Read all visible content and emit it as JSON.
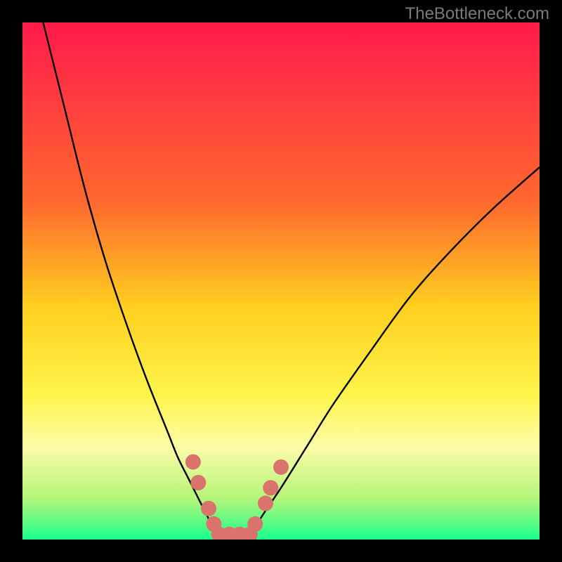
{
  "watermark": "TheBottleneck.com",
  "chart_data": {
    "type": "line",
    "title": "",
    "xlabel": "",
    "ylabel": "",
    "xlim": [
      0,
      100
    ],
    "ylim": [
      0,
      100
    ],
    "gradient_stops": [
      {
        "offset": 0,
        "color": "#ff1a4a"
      },
      {
        "offset": 35,
        "color": "#ff6a2e"
      },
      {
        "offset": 55,
        "color": "#ffcf1f"
      },
      {
        "offset": 72,
        "color": "#fff44a"
      },
      {
        "offset": 82,
        "color": "#fcfca8"
      },
      {
        "offset": 92,
        "color": "#b6f57a"
      },
      {
        "offset": 100,
        "color": "#1aff8c"
      }
    ],
    "series": [
      {
        "name": "left-curve",
        "x": [
          4,
          8,
          12,
          16,
          20,
          24,
          28,
          30,
          32,
          34,
          36,
          38
        ],
        "y": [
          100,
          84,
          68,
          54,
          42,
          31,
          21,
          16,
          12,
          8,
          4,
          0
        ]
      },
      {
        "name": "right-curve",
        "x": [
          44,
          46,
          50,
          55,
          60,
          67,
          75,
          83,
          91,
          100
        ],
        "y": [
          0,
          4,
          10,
          18,
          26,
          36,
          47,
          56,
          64,
          72
        ]
      }
    ],
    "annotations": [
      {
        "name": "left-cluster",
        "x": 33,
        "y": 15
      },
      {
        "name": "left-cluster",
        "x": 34,
        "y": 11
      },
      {
        "name": "left-cluster",
        "x": 36,
        "y": 6
      },
      {
        "name": "left-cluster",
        "x": 37,
        "y": 3
      },
      {
        "name": "bottom-cluster",
        "x": 38,
        "y": 1
      },
      {
        "name": "bottom-cluster",
        "x": 40,
        "y": 1
      },
      {
        "name": "bottom-cluster",
        "x": 42,
        "y": 1
      },
      {
        "name": "bottom-cluster",
        "x": 44,
        "y": 1
      },
      {
        "name": "right-cluster",
        "x": 45,
        "y": 3
      },
      {
        "name": "right-cluster",
        "x": 47,
        "y": 7
      },
      {
        "name": "right-cluster",
        "x": 48,
        "y": 10
      },
      {
        "name": "right-cluster",
        "x": 50,
        "y": 14
      }
    ],
    "annotation_color": "#d9736b",
    "curve_color": "#000000"
  }
}
